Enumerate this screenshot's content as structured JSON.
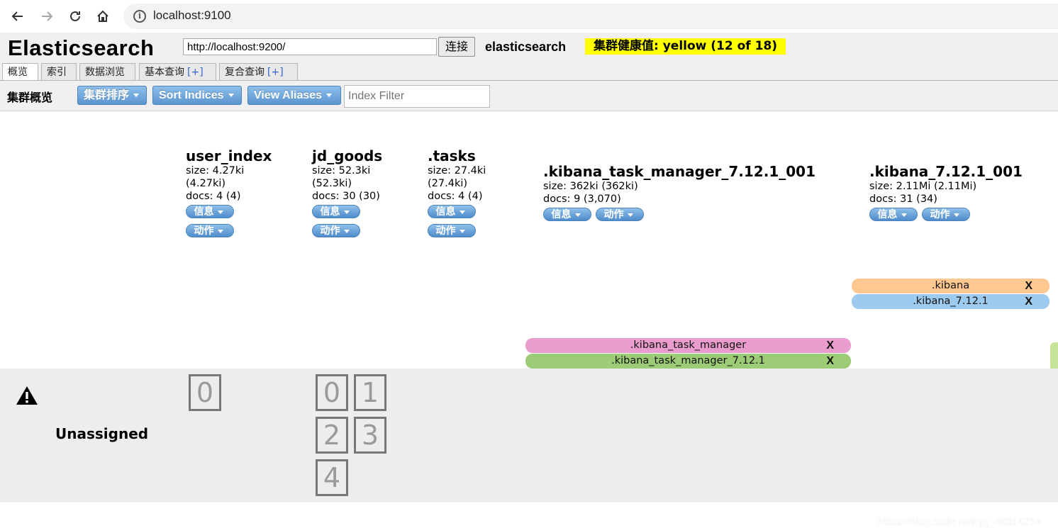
{
  "browser": {
    "url": "localhost:9100",
    "icons": [
      "back-arrow-icon",
      "forward-arrow-icon",
      "reload-icon",
      "home-icon",
      "info-icon"
    ]
  },
  "app": {
    "title": "Elasticsearch",
    "connect_url": "http://localhost:9200/",
    "connect_label": "连接",
    "cluster_name": "elasticsearch",
    "health": "集群健康值: yellow (12 of 18)",
    "health_color": "#ffff00"
  },
  "tabs": [
    {
      "label": "概览",
      "plus": ""
    },
    {
      "label": "索引",
      "plus": ""
    },
    {
      "label": "数据浏览",
      "plus": ""
    },
    {
      "label": "基本查询",
      "plus": "[+]"
    },
    {
      "label": "复合查询",
      "plus": "[+]"
    }
  ],
  "toolbar": {
    "title": "集群概览",
    "cluster_sort": "集群排序",
    "sort_indices": "Sort Indices",
    "view_aliases": "View Aliases",
    "filter_placeholder": "Index Filter"
  },
  "indices": [
    {
      "name": "user_index",
      "size_a": "size: 4.27ki",
      "size_b": "(4.27ki)",
      "docs": "docs: 4 (4)",
      "info": "信息",
      "action": "动作"
    },
    {
      "name": "jd_goods",
      "size_a": "size: 52.3ki",
      "size_b": "(52.3ki)",
      "docs": "docs: 30 (30)",
      "info": "信息",
      "action": "动作"
    },
    {
      "name": ".tasks",
      "size_a": "size: 27.4ki",
      "size_b": "(27.4ki)",
      "docs": "docs: 4 (4)",
      "info": "信息",
      "action": "动作"
    },
    {
      "name": ".kibana_task_manager_7.12.1_001",
      "size": "size: 362ki (362ki)",
      "docs": "docs: 9 (3,070)",
      "info": "信息",
      "action": "动作"
    },
    {
      "name": ".kibana_7.12.1_001",
      "size": "size: 2.11Mi (2.11Mi)",
      "docs": "docs: 31 (34)",
      "info": "信息",
      "action": "动作"
    }
  ],
  "aliases": [
    {
      "name": ".kibana",
      "close": "X",
      "color": "#ffc891"
    },
    {
      "name": ".kibana_7.12.1",
      "close": "X",
      "color": "#9ccbef"
    },
    {
      "name": ".kibana_task_manager",
      "close": "X",
      "color": "#ea9ccc"
    },
    {
      "name": ".kibana_task_manager_7.12.1",
      "close": "X",
      "color": "#9dcc77"
    }
  ],
  "unassigned": {
    "label": "Unassigned",
    "user_index_shards": [
      "0"
    ],
    "jd_goods_shards": [
      "0",
      "1",
      "2",
      "3",
      "4"
    ]
  },
  "watermark": "https://blog.csdn.net/qq_40314214"
}
